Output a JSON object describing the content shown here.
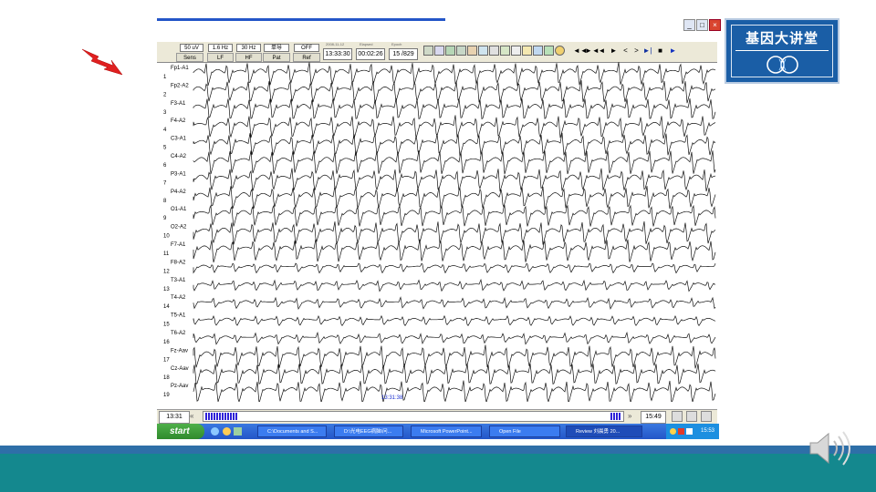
{
  "logo": {
    "title": "基因大讲堂",
    "mark": "CG"
  },
  "app": {
    "toolbar": {
      "sens": {
        "value": "50 uV",
        "label": "Sens"
      },
      "lf": {
        "value": "1.6 Hz",
        "label": "LF"
      },
      "hf": {
        "value": "30 Hz",
        "label": "HF"
      },
      "pat": {
        "value": "单导",
        "label": "Pat"
      },
      "ref": {
        "value": "OFF",
        "label": "Ref"
      },
      "date_caption": "2008-11-12",
      "clock": "13:33:30",
      "elapsed_caption": "Elapsed",
      "elapsed": "00:02:26",
      "epoch_caption": "Epoch",
      "epoch": "15 /829",
      "nav": [
        "◄◄",
        "►◄",
        "◄",
        "►",
        "<",
        ">",
        "►|",
        "■",
        "►"
      ]
    },
    "channels": [
      {
        "label": "Fp1-A1",
        "num": "1"
      },
      {
        "label": "Fp2-A2",
        "num": "2"
      },
      {
        "label": "F3-A1",
        "num": "3"
      },
      {
        "label": "F4-A2",
        "num": "4"
      },
      {
        "label": "C3-A1",
        "num": "5"
      },
      {
        "label": "C4-A2",
        "num": "6"
      },
      {
        "label": "P3-A1",
        "num": "7"
      },
      {
        "label": "P4-A2",
        "num": "8"
      },
      {
        "label": "O1-A1",
        "num": "9"
      },
      {
        "label": "O2-A2",
        "num": "10"
      },
      {
        "label": "F7-A1",
        "num": "11"
      },
      {
        "label": "F8-A2",
        "num": "12"
      },
      {
        "label": "T3-A1",
        "num": "13"
      },
      {
        "label": "T4-A2",
        "num": "14"
      },
      {
        "label": "T5-A1",
        "num": "15"
      },
      {
        "label": "T6-A2",
        "num": "16"
      },
      {
        "label": "Fz-Aav",
        "num": "17"
      },
      {
        "label": "Cz-Aav",
        "num": "18"
      },
      {
        "label": "Pz-Aav",
        "num": "19"
      }
    ],
    "marker_label": "M",
    "timestamp_marker": "13:31:38",
    "time_left": "13:31",
    "time_right": "15:49"
  },
  "taskbar": {
    "start": "start",
    "tasks": [
      "C:\\Documents and S...",
      "D:\\光电EEG病脑\\问...",
      "Microsoft PowerPoint...",
      "Open File",
      "Review  刘晨勇   20..."
    ],
    "clock": "15:53"
  },
  "colors": {
    "band_blue": "#2e6fa8",
    "band_teal": "#14888e",
    "logo_bg": "#1a5ea6"
  }
}
